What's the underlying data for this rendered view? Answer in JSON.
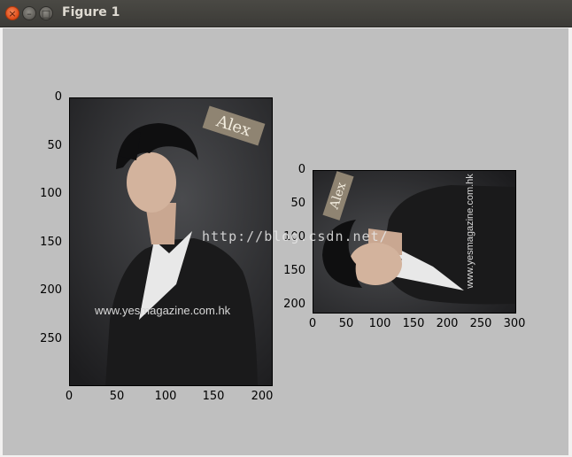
{
  "window": {
    "title": "Figure 1",
    "close_glyph": "×",
    "min_glyph": "–",
    "max_glyph": "□"
  },
  "figure": {
    "watermark": "http://blog.csdn.net/",
    "magazine_text": "www.yesmagazine.com.hk",
    "name_tag": "Alex",
    "axes_left": {
      "yticks": [
        "0",
        "50",
        "100",
        "150",
        "200",
        "250"
      ],
      "xticks": [
        "0",
        "50",
        "100",
        "150",
        "200"
      ]
    },
    "axes_right": {
      "yticks": [
        "0",
        "50",
        "100",
        "150",
        "200"
      ],
      "xticks": [
        "0",
        "50",
        "100",
        "150",
        "200",
        "250",
        "300"
      ]
    }
  },
  "colors": {
    "canvas": "#bfbfbf",
    "titlebar": "#3c3b37",
    "close_button": "#df4a16"
  }
}
